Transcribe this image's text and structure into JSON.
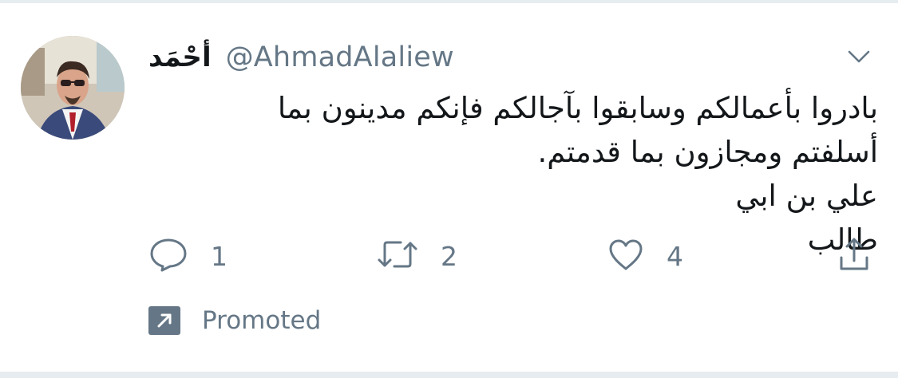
{
  "tweet": {
    "author": {
      "display_name": "أحْمَد",
      "handle": "@AhmadAlaliew"
    },
    "text_lines": [
      "بادروا بأعمالكم وسابقوا بآجالكم فإنكم مدينون بما",
      "أسلفتم ومجازون بما قدمتم.",
      "علي بن ابي طالب"
    ],
    "actions": {
      "reply_count": "1",
      "retweet_count": "2",
      "like_count": "4"
    },
    "promoted_label": "Promoted"
  },
  "icons": {
    "menu": "chevron-down-icon",
    "reply": "reply-bubble-icon",
    "retweet": "retweet-icon",
    "like": "heart-icon",
    "share": "share-icon",
    "promoted": "promoted-arrow-icon"
  },
  "colors": {
    "text_primary": "#14171a",
    "text_secondary": "#657786",
    "divider": "#e6ecf0"
  }
}
